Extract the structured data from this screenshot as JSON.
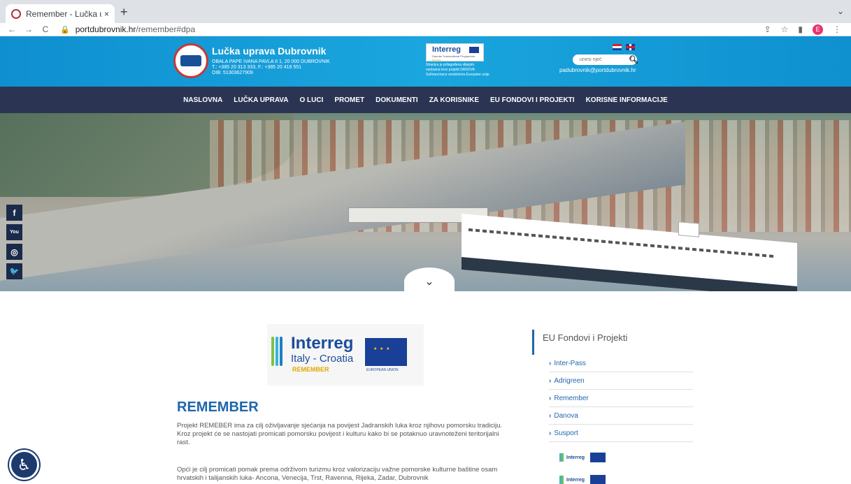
{
  "browser": {
    "tab_title": "Remember - Lučka uprava Dub",
    "tab_close": "×",
    "new_tab": "+",
    "tab_menu": "⌄",
    "url_host": "portdubrovnik.hr",
    "url_path": "/remember#dpa",
    "back": "←",
    "forward": "→",
    "reload": "C",
    "profile_initial": "E"
  },
  "header": {
    "title": "Lučka uprava Dubrovnik",
    "address": "OBALA PAPE IVANA PAVLA II 1, 20 000 DUBROVNIK",
    "phone": "T.: +385 20 313 333, F.: +385 20 418 551",
    "oib": "OIB: 51303627909",
    "interreg_logo": "Interreg",
    "interreg_sub": "Danube Transnational Programme",
    "interreg_yellow": "DANOVA",
    "interreg_note_1": "Stranica je prilagođena slijepim",
    "interreg_note_2": "osobama kroz projekt DANOVA",
    "interreg_note_3": "Sufinancirano sredstvima Europske unije",
    "search_placeholder": "unesi riječ",
    "email": "padubrovnik@portdubrovnik.hr"
  },
  "nav": {
    "items": [
      "NASLOVNA",
      "LUČKA UPRAVA",
      "O LUCI",
      "PROMET",
      "DOKUMENTI",
      "ZA KORISNIKE",
      "EU FONDOVI I PROJEKTI",
      "KORISNE INFORMACIJE"
    ]
  },
  "social": {
    "facebook": "f",
    "youtube": "You",
    "instagram": "◎",
    "twitter": "🐦"
  },
  "project_logo": {
    "line1": "Interreg",
    "line2": "Italy - Croatia",
    "line3": "REMEMBER",
    "eu": "EUROPEAN UNION"
  },
  "main": {
    "title": "REMEMBER",
    "paragraph1": "Projekt REMEBER ima za cilj oživljavanje sjećanja na povijest Jadranskih luka kroz njihovu pomorsku tradiciju. Kroz projekt će se nastojati promicati  pomorsku povijest i kulturu kako bi se potaknuo uravnoteženi teritorijalni rast.",
    "paragraph2": "Opći je cilj promicati pomak prema održivom turizmu kroz valorizaciju važne pomorske kulturne baštine osam  hrvatskih i talijanskih luka- Ancona, Venecija, Trst, Ravenna, Rijeka, Zadar, Dubrovnik"
  },
  "sidebar": {
    "title": "EU Fondovi i Projekti",
    "items": [
      "Inter-Pass",
      "Adrigreen",
      "Remember",
      "Danova",
      "Susport"
    ],
    "mini_logo_text": "Interreg"
  },
  "colors": {
    "header_blue": "#1aa6de",
    "nav_navy": "#2b3553",
    "accent": "#1f66ad"
  }
}
